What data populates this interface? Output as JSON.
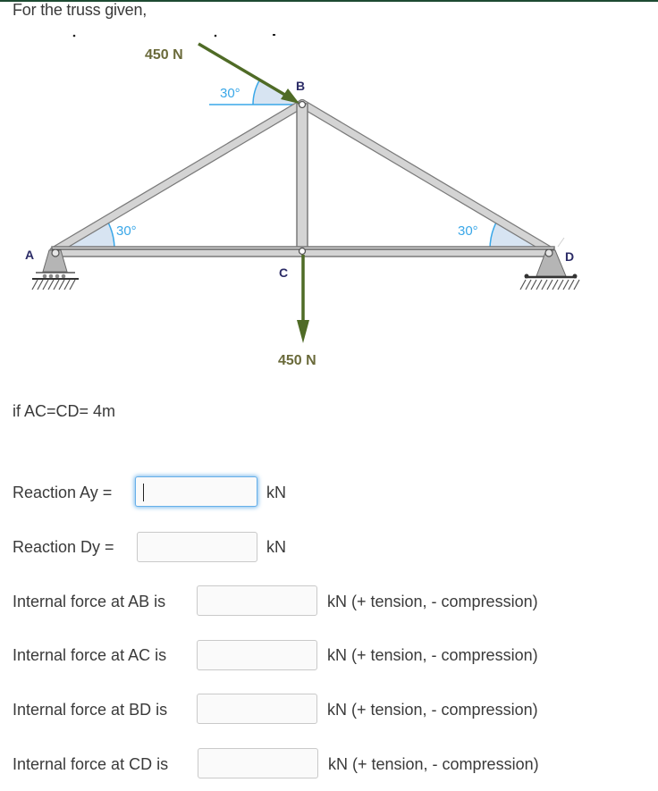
{
  "question": {
    "intro": "For the truss given,",
    "given": "if AC=CD= 4m"
  },
  "diagram": {
    "nodes": {
      "A": "A",
      "B": "B",
      "C": "C",
      "D": "D"
    },
    "applied_force_B": {
      "label": "450 N",
      "angle_label": "30°"
    },
    "applied_force_C": {
      "label": "450 N"
    },
    "angle_A_label": "30°",
    "angle_D_label": "30°",
    "colors": {
      "member": "#d4d4d4",
      "member_edge": "#7a7a7a",
      "force_arrow": "#4f6b26",
      "angle_line": "#3aa7e8",
      "angle_fill": "#d7e4f2",
      "node_label": "#2b2b66",
      "force_label": "#6a6a3a"
    }
  },
  "answers": [
    {
      "label": "Reaction Ay =",
      "value": "",
      "unit": "kN",
      "focused": true
    },
    {
      "label": "Reaction Dy =",
      "value": "",
      "unit": "kN",
      "focused": false
    },
    {
      "label": "Internal force at AB is",
      "value": "",
      "unit": "kN (+ tension, - compression)",
      "focused": false
    },
    {
      "label": "Internal force at AC is",
      "value": "",
      "unit": "kN (+ tension, - compression)",
      "focused": false
    },
    {
      "label": "Internal force at BD is",
      "value": "",
      "unit": "kN (+ tension, - compression)",
      "focused": false
    },
    {
      "label": "Internal force at CD is",
      "value": "",
      "unit": "kN (+ tension, - compression)",
      "focused": false
    }
  ]
}
